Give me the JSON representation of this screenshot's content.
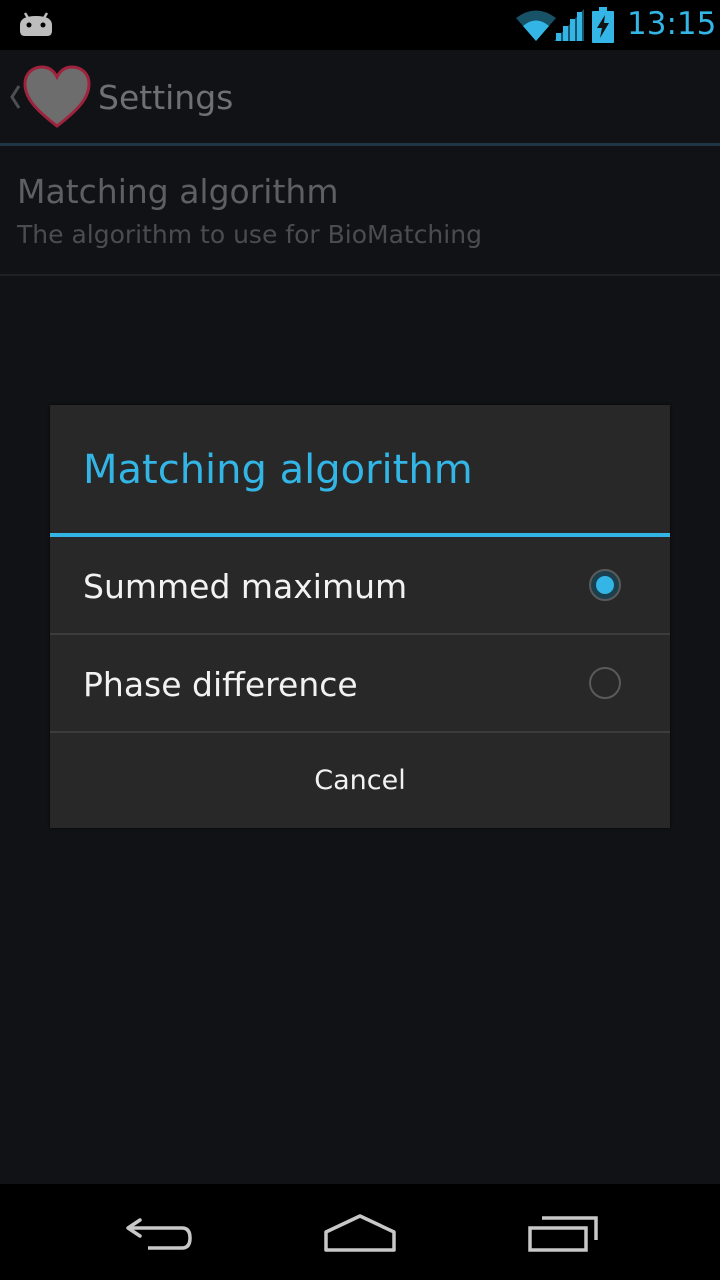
{
  "status_bar": {
    "time": "13:15",
    "icons": [
      "android-debug-icon",
      "wifi-icon",
      "signal-icon",
      "battery-charging-icon"
    ],
    "accent_color": "#33b5e5"
  },
  "action_bar": {
    "title": "Settings",
    "icons": [
      "up-caret-icon",
      "heart-logo-icon"
    ]
  },
  "preference": {
    "title": "Matching algorithm",
    "summary": "The algorithm to use for BioMatching"
  },
  "dialog": {
    "title": "Matching algorithm",
    "options": [
      {
        "label": "Summed maximum",
        "selected": true
      },
      {
        "label": "Phase difference",
        "selected": false
      }
    ],
    "cancel_label": "Cancel",
    "accent_color": "#33b5e5"
  },
  "nav_bar": {
    "icons": [
      "back-icon",
      "home-icon",
      "recent-apps-icon"
    ]
  }
}
